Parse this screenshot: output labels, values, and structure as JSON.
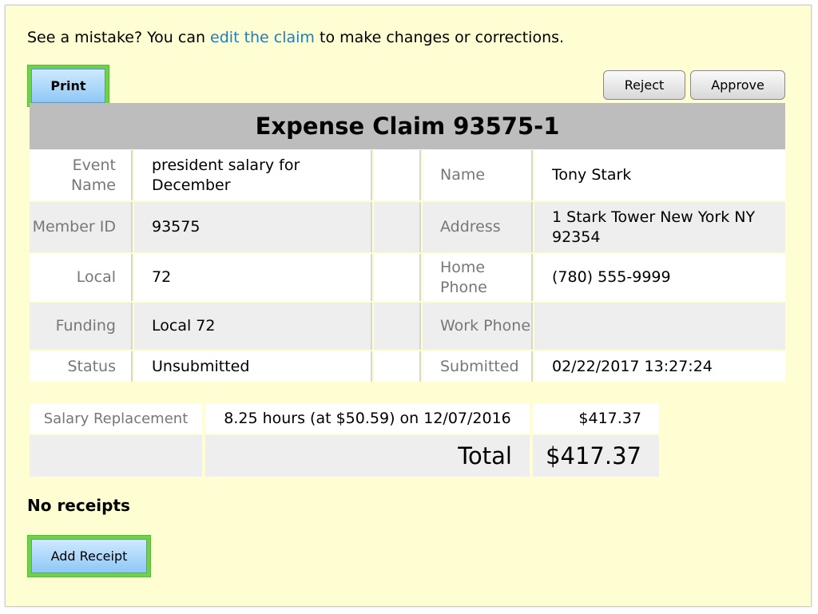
{
  "intro": {
    "before": "See a mistake? You can ",
    "link": "edit the claim",
    "after": " to make changes or corrections."
  },
  "toolbar": {
    "print_label": "Print",
    "reject_label": "Reject",
    "approve_label": "Approve"
  },
  "claim": {
    "title": "Expense Claim 93575-1",
    "rows": [
      {
        "left_label": "Event Name",
        "left_value": "president salary for December",
        "right_label": "Name",
        "right_value": "Tony Stark"
      },
      {
        "left_label": "Member ID",
        "left_value": "93575",
        "right_label": "Address",
        "right_value": "1 Stark Tower New York NY 92354"
      },
      {
        "left_label": "Local",
        "left_value": "72",
        "right_label": "Home Phone",
        "right_value": "(780) 555-9999"
      },
      {
        "left_label": "Funding",
        "left_value": "Local 72",
        "right_label": "Work Phone",
        "right_value": ""
      },
      {
        "left_label": "Status",
        "left_value": "Unsubmitted",
        "right_label": "Submitted",
        "right_value": "02/22/2017 13:27:24"
      }
    ]
  },
  "expenses": {
    "items": [
      {
        "type": "Salary Replacement",
        "description": "8.25 hours (at $50.59) on 12/07/2016",
        "amount": "$417.37"
      }
    ],
    "total_label": "Total",
    "total_amount": "$417.37"
  },
  "receipts": {
    "empty_text": "No receipts",
    "add_label": "Add Receipt"
  },
  "colors": {
    "panel_bg": "#fffdd2",
    "link": "#1a7fc1",
    "green_frame": "#6fd14a",
    "header_bg": "#bdbdbd"
  }
}
